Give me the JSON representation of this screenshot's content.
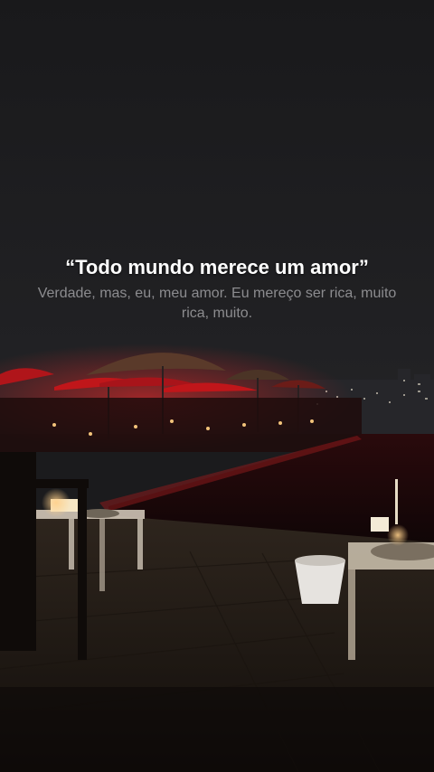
{
  "caption": {
    "title": "“Todo mundo merece um amor”",
    "subtitle": "Verdade, mas, eu, meu amor. Eu mereço ser rica, muito rica, muito."
  },
  "colors": {
    "sky": "#1b1b1d",
    "umbrella_red": "#c0161a",
    "deck": "#3a2e24",
    "water": "#160708",
    "lamp_glow": "#f5c27a"
  }
}
